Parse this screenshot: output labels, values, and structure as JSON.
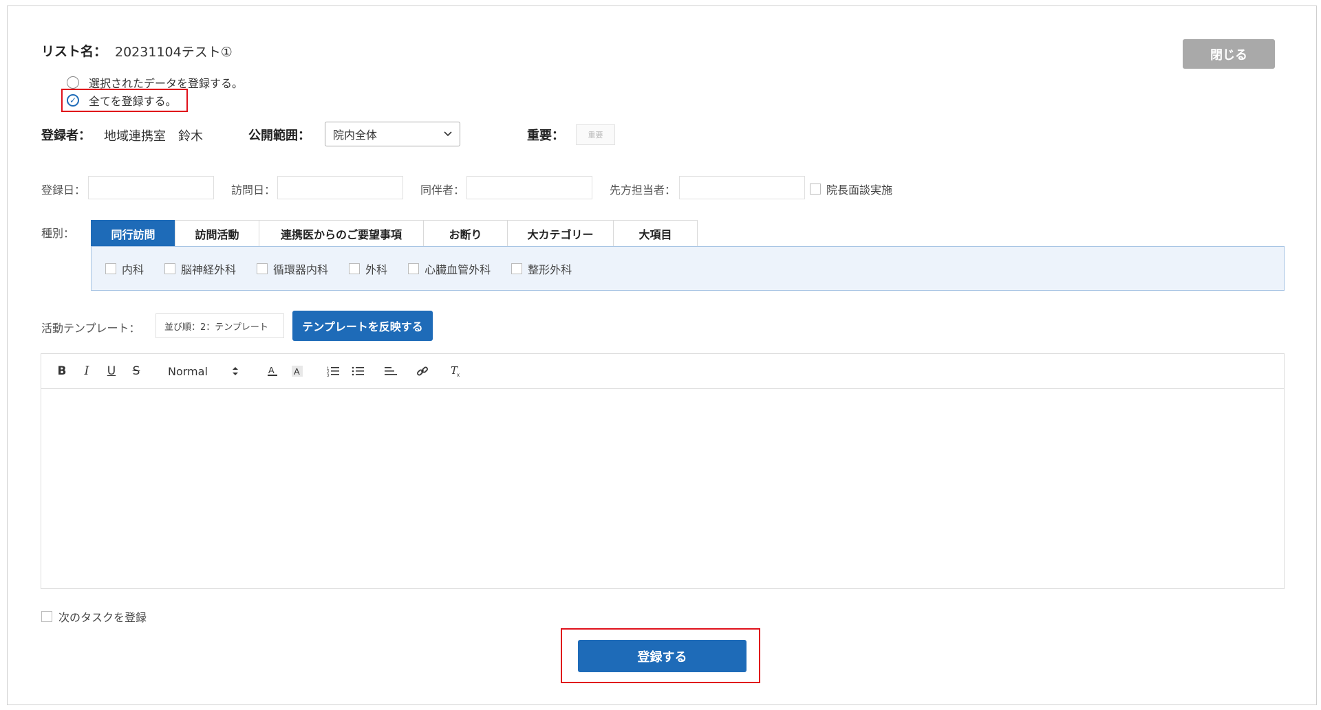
{
  "header": {
    "list_label": "リスト名：",
    "list_value": "20231104テスト①",
    "close_label": "閉じる"
  },
  "register_options": [
    {
      "label": "選択されたデータを登録する。",
      "checked": false
    },
    {
      "label": "全てを登録する。",
      "checked": true
    }
  ],
  "info_row": {
    "registrant_label": "登録者：",
    "registrant_value": "地域連携室　鈴木",
    "scope_label": "公開範囲：",
    "scope_value": "院内全体",
    "importance_label": "重要：",
    "importance_button": "重要"
  },
  "date_row": {
    "register_date_label": "登録日：",
    "register_date_value": "",
    "visit_date_label": "訪問日：",
    "visit_date_value": "",
    "companion_label": "同伴者：",
    "companion_value": "",
    "counterpart_label": "先方担当者：",
    "counterpart_value": "",
    "director_interview_label": "院長面談実施"
  },
  "category": {
    "label": "種別：",
    "tabs": [
      {
        "label": "同行訪問",
        "active": true
      },
      {
        "label": "訪問活動",
        "active": false
      },
      {
        "label": "連携医からのご要望事項",
        "active": false
      },
      {
        "label": "お断り",
        "active": false
      },
      {
        "label": "大カテゴリー",
        "active": false
      },
      {
        "label": "大項目",
        "active": false
      }
    ],
    "options": [
      "内科",
      "脳神経外科",
      "循環器内科",
      "外科",
      "心臓血管外科",
      "整形外科"
    ]
  },
  "template": {
    "label": "活動テンプレート：",
    "select_value": "並び順：2：テンプレート",
    "apply_label": "テンプレートを反映する"
  },
  "editor": {
    "normal_label": "Normal",
    "content": ""
  },
  "next_task_label": "次のタスクを登録",
  "submit_label": "登録する",
  "colors": {
    "primary": "#1e6bb8",
    "highlight": "#e0101a",
    "close_button": "#a9a9a9",
    "tab_panel_bg": "#edf3fb"
  }
}
